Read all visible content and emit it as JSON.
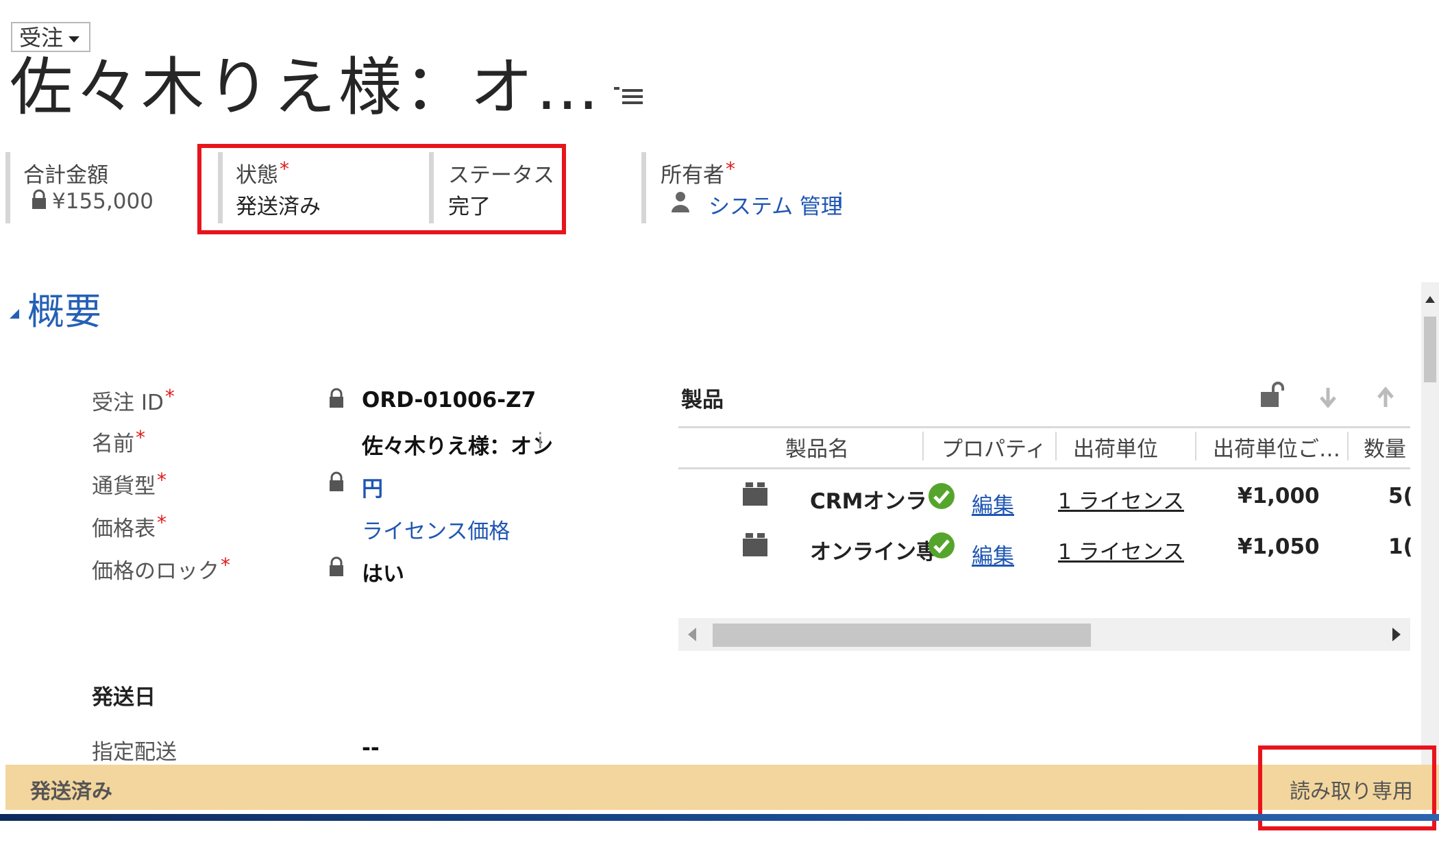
{
  "header": {
    "entity_selector": "受注",
    "record_title": "佐々木りえ様：オ…",
    "total": {
      "label": "合計金額",
      "value": "¥155,000"
    },
    "state": {
      "label": "状態",
      "value": "発送済み"
    },
    "status": {
      "label": "ステータス",
      "value": "完了"
    },
    "owner": {
      "label": "所有者",
      "value": "システム 管理",
      "info": "i"
    }
  },
  "section": {
    "title": "概要"
  },
  "fields": [
    {
      "label": "受注 ID",
      "value": "ORD-01006-Z7"
    },
    {
      "label": "名前",
      "value": "佐々木りえ様：オン",
      "info": "i"
    },
    {
      "label": "通貨型",
      "value": "円"
    },
    {
      "label": "価格表",
      "value": "ライセンス価格"
    },
    {
      "label": "価格のロック",
      "value": "はい"
    }
  ],
  "shipping": {
    "title": "発送日",
    "field_label": "指定配送",
    "field_value": "--"
  },
  "products": {
    "title": "製品",
    "columns": [
      "製品名",
      "プロパティ",
      "出荷単位",
      "出荷単位ご…",
      "数量"
    ],
    "rows": [
      {
        "name": "CRMオンラ",
        "edit": "編集",
        "unit": "1 ライセンス",
        "price": "¥1,000",
        "qty": "5("
      },
      {
        "name": "オンライン専",
        "edit": "編集",
        "unit": "1 ライセンス",
        "price": "¥1,050",
        "qty": "1("
      }
    ]
  },
  "status_bar": {
    "state": "発送済み",
    "mode": "読み取り専用"
  },
  "colors": {
    "accent_blue": "#2560b5",
    "highlight_red": "#e8141c",
    "status_bar": "#f3d69d",
    "required": "#e01b1b"
  }
}
